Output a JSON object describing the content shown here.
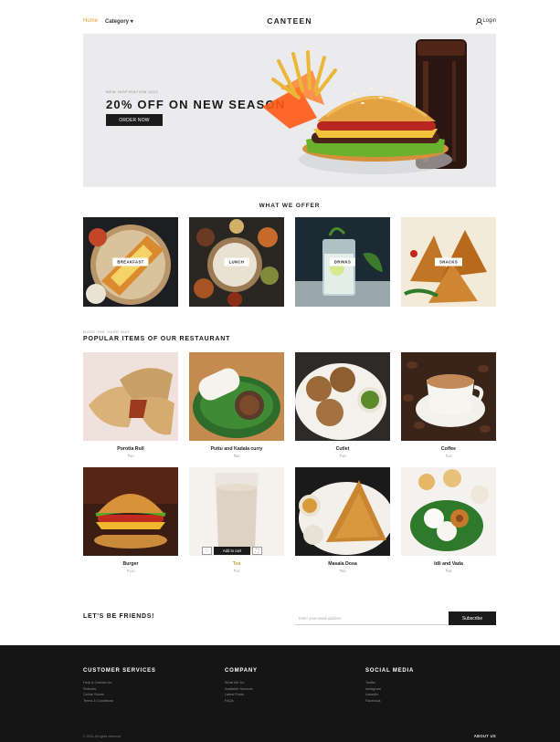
{
  "nav": {
    "home_label": "Home",
    "category_label": "Category ▾",
    "brand": "CANTEEN",
    "login_label": "Login"
  },
  "hero": {
    "eyebrow": "NEW INSPIRATION 2021",
    "headline": "20% OFF ON NEW SEASON",
    "cta_label": "ORDER NOW"
  },
  "offer": {
    "title": "WHAT WE OFFER",
    "categories": [
      {
        "label": "BREAKFAST"
      },
      {
        "label": "LUNCH"
      },
      {
        "label": "DRINKS"
      },
      {
        "label": "SNACKS"
      }
    ]
  },
  "popular": {
    "eyebrow": "MADE THE HARD WAY",
    "title": "POPULAR ITEMS OF OUR RESTAURANT",
    "items": [
      {
        "name": "Porotta Roll",
        "price": "₹40"
      },
      {
        "name": "Puttu and Kadala curry",
        "price": "₹50"
      },
      {
        "name": "Cutlet",
        "price": "₹15"
      },
      {
        "name": "Coffee",
        "price": "₹10"
      },
      {
        "name": "Burger",
        "price": "₹110"
      },
      {
        "name": "Tea",
        "price": "₹10"
      },
      {
        "name": "Masala Dosa",
        "price": "₹65"
      },
      {
        "name": "Idli and Vada",
        "price": "₹45"
      }
    ],
    "add_to_cart_label": "Add to cart"
  },
  "newsletter": {
    "title": "LET'S BE FRIENDS!",
    "placeholder": "Enter your email address",
    "button_label": "Subscribe"
  },
  "footer": {
    "customer_services": {
      "title": "CUSTOMER SERVICES",
      "links": [
        "Help & Contact Us",
        "Refunds",
        "Online Stores",
        "Terms & Conditions"
      ]
    },
    "company": {
      "title": "COMPANY",
      "links": [
        "What We Do",
        "Available Services",
        "Latest Posts",
        "FAQs"
      ]
    },
    "social": {
      "title": "SOCIAL MEDIA",
      "links": [
        "Twitter",
        "Instagram",
        "LinkedIn",
        "Facebook"
      ]
    },
    "copyright": "© 2021 All rights reserved",
    "brand_credit": "ABOUT US"
  },
  "colors": {
    "accent": "#e0a030",
    "dark": "#1b1b1b",
    "footer_bg": "#151515",
    "hero_bg": "#ebebed"
  }
}
